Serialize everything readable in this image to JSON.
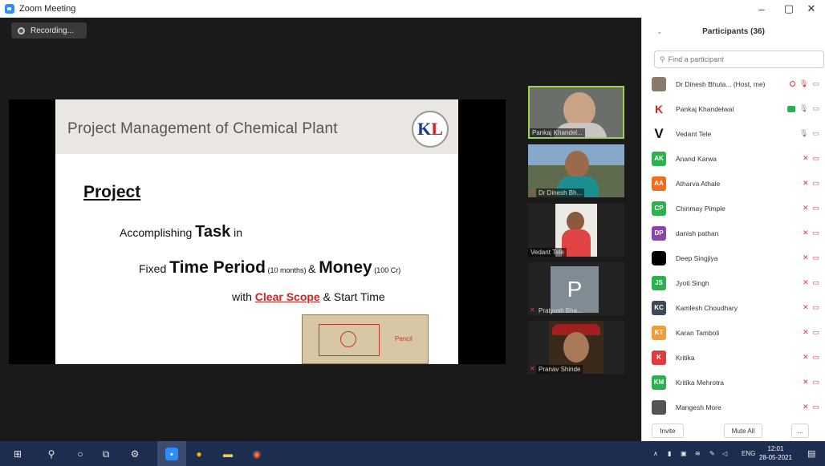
{
  "window": {
    "title": "Zoom Meeting",
    "controls": {
      "minimize": "–",
      "maximize": "▢",
      "close": "✕"
    }
  },
  "meeting": {
    "recording_label": "Recording...",
    "slide": {
      "title": "Project Management of Chemical Plant",
      "logo_text_k": "K",
      "logo_text_l": "L",
      "heading": "Project",
      "line1_pre": "Accomplishing ",
      "line1_bold": "Task",
      "line1_post": " in",
      "line2_pre": "Fixed ",
      "line2_bold1": "Time Period",
      "line2_small1": " (10 months) ",
      "line2_amp": "& ",
      "line2_bold2": "Money",
      "line2_small2": " (100 Cr)",
      "line3_pre": "with ",
      "line3_scope": "Clear Scope",
      "line3_post": " & Start Time",
      "figure_label": "Pencil"
    },
    "tiles": [
      {
        "name": "Pankaj Khandel...",
        "muted": false,
        "active": true
      },
      {
        "name": "Dr Dinesh Bh...",
        "muted": true,
        "active": false
      },
      {
        "name": "Vedant Tele",
        "muted": false,
        "active": false
      },
      {
        "name": "Pratyush Bha...",
        "muted": true,
        "active": false,
        "letter": "P"
      },
      {
        "name": "Pranav Shinde",
        "muted": true,
        "active": false
      }
    ]
  },
  "participants": {
    "title": "Participants (36)",
    "search_placeholder": "Find a participant",
    "items": [
      {
        "name": "Dr Dinesh Bhuta...",
        "role": "(Host, me)",
        "avatar": "",
        "avatar_color": "#8a7a6a"
      },
      {
        "name": "Pankaj Khandelwal",
        "role": "",
        "avatar": "K",
        "avatar_color": "#ffffff"
      },
      {
        "name": "Vedant Tele",
        "role": "",
        "avatar": "V",
        "avatar_color": "#ffffff"
      },
      {
        "name": "Anand Karwa",
        "role": "",
        "avatar": "AK",
        "avatar_color": "#2bb24c"
      },
      {
        "name": "Atharva Athale",
        "role": "",
        "avatar": "AA",
        "avatar_color": "#f26d21"
      },
      {
        "name": "Chinmay Pimple",
        "role": "",
        "avatar": "CP",
        "avatar_color": "#2bb24c"
      },
      {
        "name": "danish pathan",
        "role": "",
        "avatar": "DP",
        "avatar_color": "#8e44ad"
      },
      {
        "name": "Deep Singjiya",
        "role": "",
        "avatar": "",
        "avatar_color": "#000000"
      },
      {
        "name": "Jyoti Singh",
        "role": "",
        "avatar": "JS",
        "avatar_color": "#2bb24c"
      },
      {
        "name": "Kamlesh Choudhary",
        "role": "",
        "avatar": "KC",
        "avatar_color": "#3c4a5c"
      },
      {
        "name": "Karan Tamboli",
        "role": "",
        "avatar": "KT",
        "avatar_color": "#f39c3a"
      },
      {
        "name": "Kritika",
        "role": "",
        "avatar": "K",
        "avatar_color": "#e0393e"
      },
      {
        "name": "Kritika Mehrotra",
        "role": "",
        "avatar": "KM",
        "avatar_color": "#2bb24c"
      },
      {
        "name": "Mangesh More",
        "role": "",
        "avatar": "",
        "avatar_color": "#555555"
      }
    ],
    "footer": {
      "invite": "Invite",
      "mute_all": "Mute All",
      "more": "..."
    }
  },
  "taskbar": {
    "language": "ENG",
    "time": "12:01",
    "date": "28-05-2021"
  },
  "colors": {
    "zoom_blue": "#2d8cff",
    "mute_red": "#e0393e",
    "active_green": "#9ed14b",
    "taskbar": "#1d2d4f"
  }
}
